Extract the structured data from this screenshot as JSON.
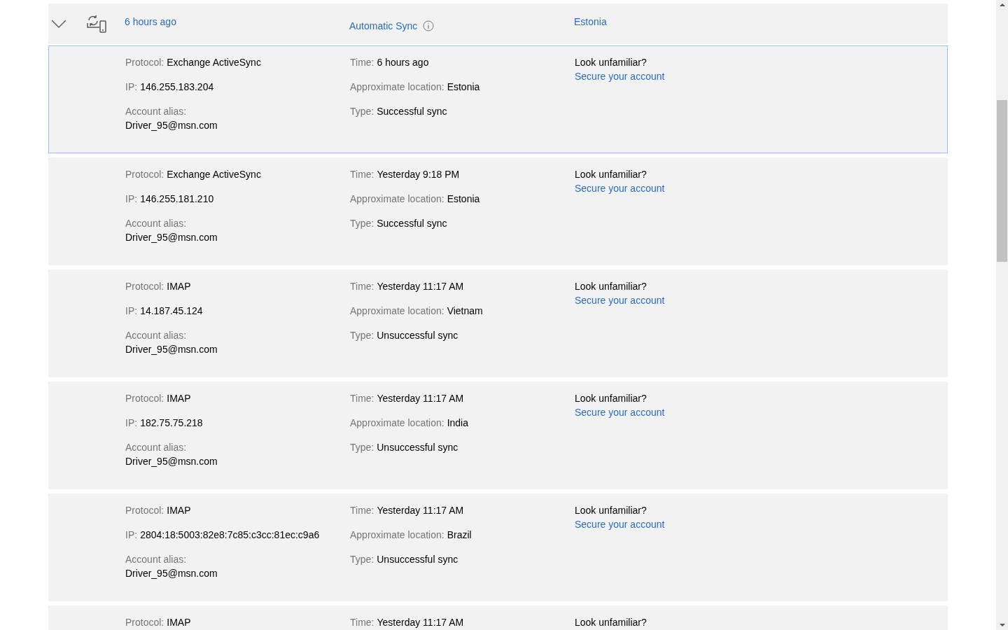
{
  "header": {
    "expanded": true,
    "time": "6 hours ago",
    "type": "Automatic Sync",
    "location": "Estonia"
  },
  "entries": [
    {
      "selected": true,
      "protocol_label": "Protocol:",
      "protocol": "Exchange ActiveSync",
      "ip_label": "IP:",
      "ip": "146.255.183.204",
      "alias_label": "Account alias:",
      "alias": "Driver_95@msn.com",
      "time_label": "Time:",
      "time": "6 hours ago",
      "location_label": "Approximate location:",
      "location": "Estonia",
      "type_label": "Type:",
      "type": "Successful sync",
      "prompt": "Look unfamiliar?",
      "link": "Secure your account"
    },
    {
      "selected": false,
      "protocol_label": "Protocol:",
      "protocol": "Exchange ActiveSync",
      "ip_label": "IP:",
      "ip": "146.255.181.210",
      "alias_label": "Account alias:",
      "alias": "Driver_95@msn.com",
      "time_label": "Time:",
      "time": "Yesterday 9:18 PM",
      "location_label": "Approximate location:",
      "location": "Estonia",
      "type_label": "Type:",
      "type": "Successful sync",
      "prompt": "Look unfamiliar?",
      "link": "Secure your account"
    },
    {
      "selected": false,
      "protocol_label": "Protocol:",
      "protocol": "IMAP",
      "ip_label": "IP:",
      "ip": "14.187.45.124",
      "alias_label": "Account alias:",
      "alias": "Driver_95@msn.com",
      "time_label": "Time:",
      "time": "Yesterday 11:17 AM",
      "location_label": "Approximate location:",
      "location": "Vietnam",
      "type_label": "Type:",
      "type": "Unsuccessful sync",
      "prompt": "Look unfamiliar?",
      "link": "Secure your account"
    },
    {
      "selected": false,
      "protocol_label": "Protocol:",
      "protocol": "IMAP",
      "ip_label": "IP:",
      "ip": "182.75.75.218",
      "alias_label": "Account alias:",
      "alias": "Driver_95@msn.com",
      "time_label": "Time:",
      "time": "Yesterday 11:17 AM",
      "location_label": "Approximate location:",
      "location": "India",
      "type_label": "Type:",
      "type": "Unsuccessful sync",
      "prompt": "Look unfamiliar?",
      "link": "Secure your account"
    },
    {
      "selected": false,
      "protocol_label": "Protocol:",
      "protocol": "IMAP",
      "ip_label": "IP:",
      "ip": "2804:18:5003:82e8:7c85:c3cc:81ec:c9a6",
      "alias_label": "Account alias:",
      "alias": "Driver_95@msn.com",
      "time_label": "Time:",
      "time": "Yesterday 11:17 AM",
      "location_label": "Approximate location:",
      "location": "Brazil",
      "type_label": "Type:",
      "type": "Unsuccessful sync",
      "prompt": "Look unfamiliar?",
      "link": "Secure your account"
    },
    {
      "selected": false,
      "protocol_label": "Protocol:",
      "protocol": "IMAP",
      "time_label": "Time:",
      "time": "Yesterday 11:17 AM",
      "prompt": "Look unfamiliar?"
    }
  ]
}
